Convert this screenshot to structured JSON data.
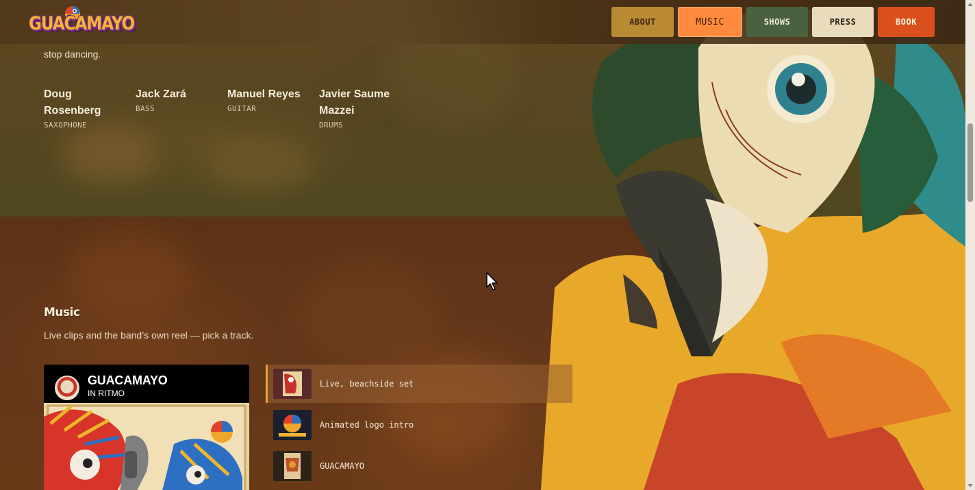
{
  "header": {
    "logo_text": "GUACAMAYO",
    "nav": [
      {
        "label": "ABOUT"
      },
      {
        "label": "MUSIC"
      },
      {
        "label": "SHOWS"
      },
      {
        "label": "PRESS"
      },
      {
        "label": "BOOK"
      }
    ],
    "active_nav": "MUSIC"
  },
  "about": {
    "intro_tail": "stop dancing.",
    "members": [
      {
        "name": "Doug Rosenberg",
        "role": "SAXOPHONE"
      },
      {
        "name": "Jack Zará",
        "role": "BASS"
      },
      {
        "name": "Manuel Reyes",
        "role": "GUITAR"
      },
      {
        "name": "Javier Saume Mazzei",
        "role": "DRUMS"
      }
    ]
  },
  "music": {
    "title": "Music",
    "subtitle": "Live clips and the band’s own reel — pick a track.",
    "player": {
      "title": "GUACAMAYO",
      "subtitle": "IN RITMO"
    },
    "tracks": [
      {
        "label": "Live, beachside set",
        "active": true
      },
      {
        "label": "Animated logo intro",
        "active": false
      },
      {
        "label": "GUACAMAYO",
        "active": false
      }
    ]
  },
  "colors": {
    "nav_about": "#b88a33",
    "nav_music": "#ff8a3d",
    "nav_shows": "#4a6140",
    "nav_press": "#e8dcbc",
    "nav_book": "#d9501c",
    "active_track_accent": "#f0a130"
  }
}
